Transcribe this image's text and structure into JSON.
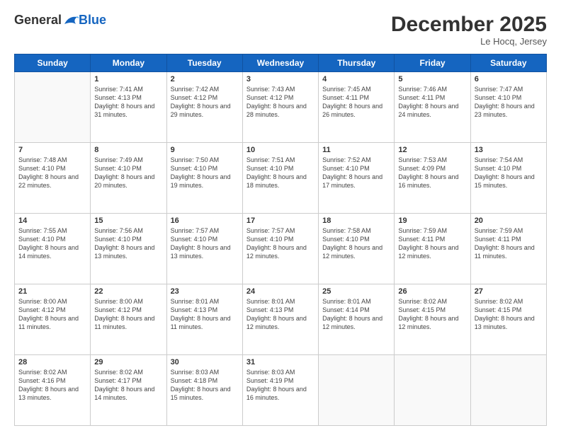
{
  "header": {
    "logo_general": "General",
    "logo_blue": "Blue",
    "month": "December 2025",
    "location": "Le Hocq, Jersey"
  },
  "weekdays": [
    "Sunday",
    "Monday",
    "Tuesday",
    "Wednesday",
    "Thursday",
    "Friday",
    "Saturday"
  ],
  "rows": [
    [
      {
        "day": "",
        "sunrise": "",
        "sunset": "",
        "daylight": ""
      },
      {
        "day": "1",
        "sunrise": "Sunrise: 7:41 AM",
        "sunset": "Sunset: 4:13 PM",
        "daylight": "Daylight: 8 hours and 31 minutes."
      },
      {
        "day": "2",
        "sunrise": "Sunrise: 7:42 AM",
        "sunset": "Sunset: 4:12 PM",
        "daylight": "Daylight: 8 hours and 29 minutes."
      },
      {
        "day": "3",
        "sunrise": "Sunrise: 7:43 AM",
        "sunset": "Sunset: 4:12 PM",
        "daylight": "Daylight: 8 hours and 28 minutes."
      },
      {
        "day": "4",
        "sunrise": "Sunrise: 7:45 AM",
        "sunset": "Sunset: 4:11 PM",
        "daylight": "Daylight: 8 hours and 26 minutes."
      },
      {
        "day": "5",
        "sunrise": "Sunrise: 7:46 AM",
        "sunset": "Sunset: 4:11 PM",
        "daylight": "Daylight: 8 hours and 24 minutes."
      },
      {
        "day": "6",
        "sunrise": "Sunrise: 7:47 AM",
        "sunset": "Sunset: 4:10 PM",
        "daylight": "Daylight: 8 hours and 23 minutes."
      }
    ],
    [
      {
        "day": "7",
        "sunrise": "Sunrise: 7:48 AM",
        "sunset": "Sunset: 4:10 PM",
        "daylight": "Daylight: 8 hours and 22 minutes."
      },
      {
        "day": "8",
        "sunrise": "Sunrise: 7:49 AM",
        "sunset": "Sunset: 4:10 PM",
        "daylight": "Daylight: 8 hours and 20 minutes."
      },
      {
        "day": "9",
        "sunrise": "Sunrise: 7:50 AM",
        "sunset": "Sunset: 4:10 PM",
        "daylight": "Daylight: 8 hours and 19 minutes."
      },
      {
        "day": "10",
        "sunrise": "Sunrise: 7:51 AM",
        "sunset": "Sunset: 4:10 PM",
        "daylight": "Daylight: 8 hours and 18 minutes."
      },
      {
        "day": "11",
        "sunrise": "Sunrise: 7:52 AM",
        "sunset": "Sunset: 4:10 PM",
        "daylight": "Daylight: 8 hours and 17 minutes."
      },
      {
        "day": "12",
        "sunrise": "Sunrise: 7:53 AM",
        "sunset": "Sunset: 4:09 PM",
        "daylight": "Daylight: 8 hours and 16 minutes."
      },
      {
        "day": "13",
        "sunrise": "Sunrise: 7:54 AM",
        "sunset": "Sunset: 4:10 PM",
        "daylight": "Daylight: 8 hours and 15 minutes."
      }
    ],
    [
      {
        "day": "14",
        "sunrise": "Sunrise: 7:55 AM",
        "sunset": "Sunset: 4:10 PM",
        "daylight": "Daylight: 8 hours and 14 minutes."
      },
      {
        "day": "15",
        "sunrise": "Sunrise: 7:56 AM",
        "sunset": "Sunset: 4:10 PM",
        "daylight": "Daylight: 8 hours and 13 minutes."
      },
      {
        "day": "16",
        "sunrise": "Sunrise: 7:57 AM",
        "sunset": "Sunset: 4:10 PM",
        "daylight": "Daylight: 8 hours and 13 minutes."
      },
      {
        "day": "17",
        "sunrise": "Sunrise: 7:57 AM",
        "sunset": "Sunset: 4:10 PM",
        "daylight": "Daylight: 8 hours and 12 minutes."
      },
      {
        "day": "18",
        "sunrise": "Sunrise: 7:58 AM",
        "sunset": "Sunset: 4:10 PM",
        "daylight": "Daylight: 8 hours and 12 minutes."
      },
      {
        "day": "19",
        "sunrise": "Sunrise: 7:59 AM",
        "sunset": "Sunset: 4:11 PM",
        "daylight": "Daylight: 8 hours and 12 minutes."
      },
      {
        "day": "20",
        "sunrise": "Sunrise: 7:59 AM",
        "sunset": "Sunset: 4:11 PM",
        "daylight": "Daylight: 8 hours and 11 minutes."
      }
    ],
    [
      {
        "day": "21",
        "sunrise": "Sunrise: 8:00 AM",
        "sunset": "Sunset: 4:12 PM",
        "daylight": "Daylight: 8 hours and 11 minutes."
      },
      {
        "day": "22",
        "sunrise": "Sunrise: 8:00 AM",
        "sunset": "Sunset: 4:12 PM",
        "daylight": "Daylight: 8 hours and 11 minutes."
      },
      {
        "day": "23",
        "sunrise": "Sunrise: 8:01 AM",
        "sunset": "Sunset: 4:13 PM",
        "daylight": "Daylight: 8 hours and 11 minutes."
      },
      {
        "day": "24",
        "sunrise": "Sunrise: 8:01 AM",
        "sunset": "Sunset: 4:13 PM",
        "daylight": "Daylight: 8 hours and 12 minutes."
      },
      {
        "day": "25",
        "sunrise": "Sunrise: 8:01 AM",
        "sunset": "Sunset: 4:14 PM",
        "daylight": "Daylight: 8 hours and 12 minutes."
      },
      {
        "day": "26",
        "sunrise": "Sunrise: 8:02 AM",
        "sunset": "Sunset: 4:15 PM",
        "daylight": "Daylight: 8 hours and 12 minutes."
      },
      {
        "day": "27",
        "sunrise": "Sunrise: 8:02 AM",
        "sunset": "Sunset: 4:15 PM",
        "daylight": "Daylight: 8 hours and 13 minutes."
      }
    ],
    [
      {
        "day": "28",
        "sunrise": "Sunrise: 8:02 AM",
        "sunset": "Sunset: 4:16 PM",
        "daylight": "Daylight: 8 hours and 13 minutes."
      },
      {
        "day": "29",
        "sunrise": "Sunrise: 8:02 AM",
        "sunset": "Sunset: 4:17 PM",
        "daylight": "Daylight: 8 hours and 14 minutes."
      },
      {
        "day": "30",
        "sunrise": "Sunrise: 8:03 AM",
        "sunset": "Sunset: 4:18 PM",
        "daylight": "Daylight: 8 hours and 15 minutes."
      },
      {
        "day": "31",
        "sunrise": "Sunrise: 8:03 AM",
        "sunset": "Sunset: 4:19 PM",
        "daylight": "Daylight: 8 hours and 16 minutes."
      },
      {
        "day": "",
        "sunrise": "",
        "sunset": "",
        "daylight": ""
      },
      {
        "day": "",
        "sunrise": "",
        "sunset": "",
        "daylight": ""
      },
      {
        "day": "",
        "sunrise": "",
        "sunset": "",
        "daylight": ""
      }
    ]
  ]
}
